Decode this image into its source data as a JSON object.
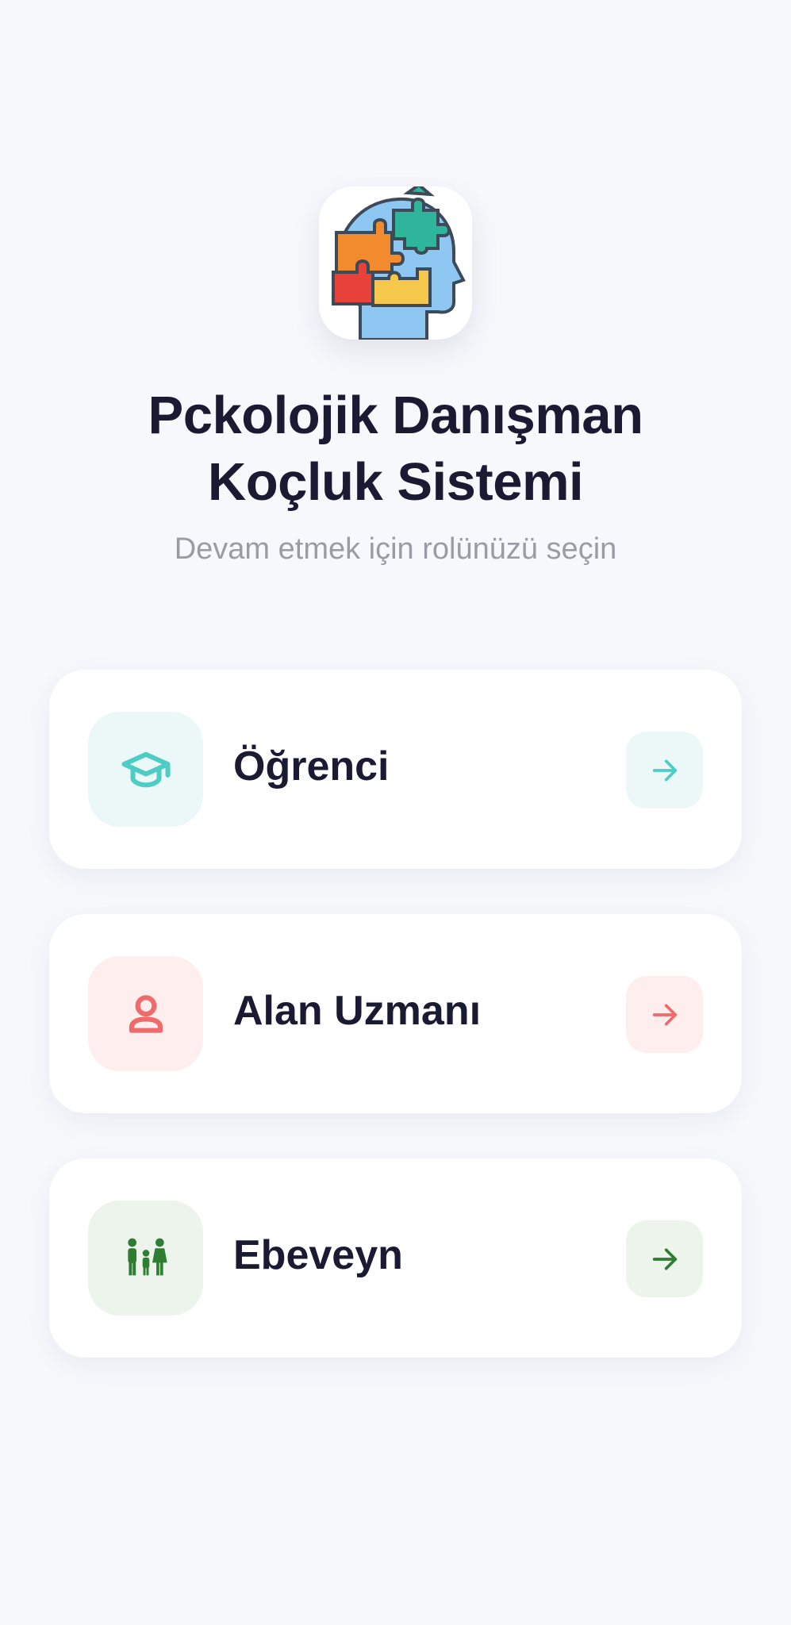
{
  "app": {
    "title_line1": "Pckolojik Danışman",
    "title_line2": "Koçluk Sistemi",
    "subtitle": "Devam etmek için rolünüzü seçin"
  },
  "roles": [
    {
      "label": "Öğrenci",
      "icon": "graduation-cap-icon",
      "accent": "#4ecdc4",
      "tint": "#ecf8f7"
    },
    {
      "label": "Alan Uzmanı",
      "icon": "person-icon",
      "accent": "#ef6b6b",
      "tint": "#feeeee"
    },
    {
      "label": "Ebeveyn",
      "icon": "family-icon",
      "accent": "#2e7d32",
      "tint": "#edf4ec"
    }
  ]
}
